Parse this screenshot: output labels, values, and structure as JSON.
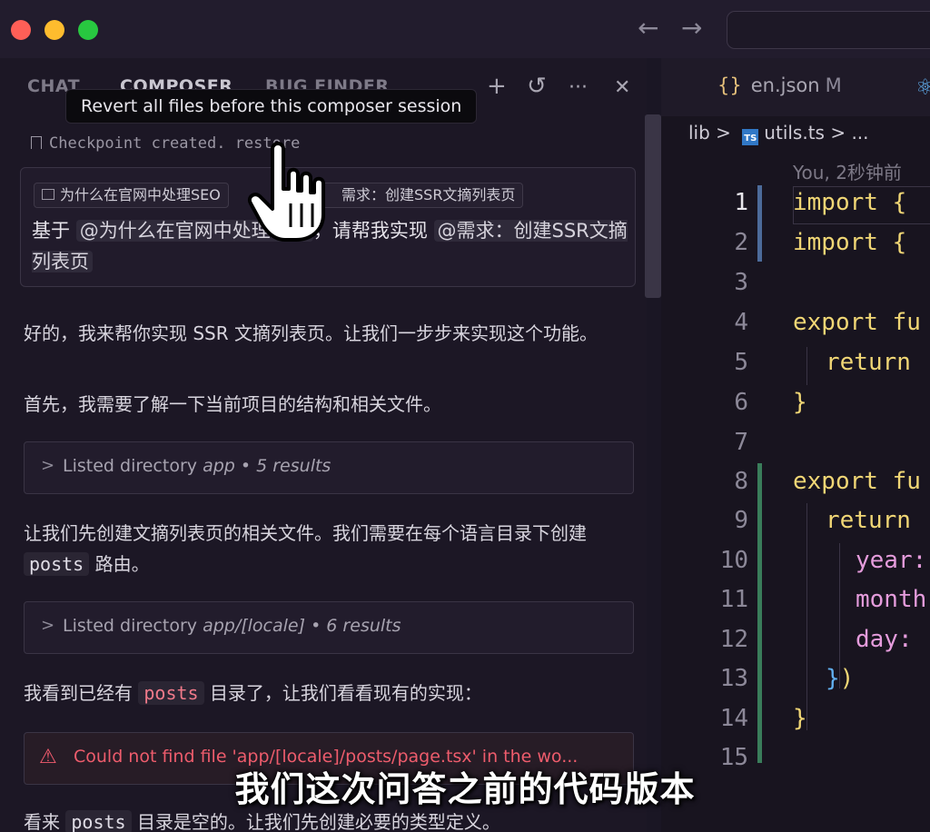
{
  "window": {
    "back_icon": "←",
    "forward_icon": "→"
  },
  "chat_panel": {
    "tabs": [
      "CHAT",
      "COMPOSER",
      "BUG FINDER"
    ],
    "icons": {
      "add": "+",
      "history": "↺",
      "more": "···",
      "close": "✕"
    },
    "tooltip": "Revert all files before this composer session",
    "checkpoint": "Checkpoint created. restore",
    "context_chips": [
      "为什么在官网中处理SEO",
      "需求：创建SSR文摘列表页"
    ],
    "prompt": {
      "prefix": "基于",
      "mention1": "@为什么在官网中处理SEO",
      "middle": "，请帮我实现",
      "mention2": "@需求：创建SSR文摘列表页"
    },
    "messages": {
      "m1": "好的，我来帮你实现 SSR 文摘列表页。让我们一步步来实现这个功能。",
      "m2": "首先，我需要了解一下当前项目的结构和相关文件。",
      "m3_a": "让我们先创建文摘列表页的相关文件。我们需要在每个语言目录下创建",
      "m3_code": "posts",
      "m3_b": "路由。",
      "m4_a": "我看到已经有",
      "m4_code": "posts",
      "m4_b": "目录了，让我们看看现有的实现：",
      "m5_a": "看来",
      "m5_code": "posts",
      "m5_b": "目录是空的。让我们先创建必要的类型定义。"
    },
    "tools": [
      {
        "label": "Listed directory",
        "path": "app",
        "count": "• 5 results"
      },
      {
        "label": "Listed directory",
        "path": "app/[locale]",
        "count": "• 6 results"
      }
    ],
    "error": "Could not find file 'app/[locale]/posts/page.tsx' in the wo..."
  },
  "editor": {
    "tab": {
      "name": "en.json",
      "modified": "M"
    },
    "breadcrumb": {
      "folder": "lib",
      "sep": ">",
      "file": "utils.ts",
      "tail": "> ..."
    },
    "blame": "You, 2秒钟前",
    "lines": [
      "1",
      "2",
      "3",
      "4",
      "5",
      "6",
      "7",
      "8",
      "9",
      "10",
      "11",
      "12",
      "13",
      "14",
      "15"
    ],
    "code": {
      "l1": "import {",
      "l2": "import {",
      "l4a": "export",
      "l4b": " fu",
      "l5": "return",
      "l6": "}",
      "l8a": "export",
      "l8b": " fu",
      "l9": "return",
      "l10": "year:",
      "l11": "month",
      "l12": "day:",
      "l13a": "}",
      "l13b": ")",
      "l14": "}"
    }
  },
  "subtitle": "我们这次问答之前的代码版本"
}
